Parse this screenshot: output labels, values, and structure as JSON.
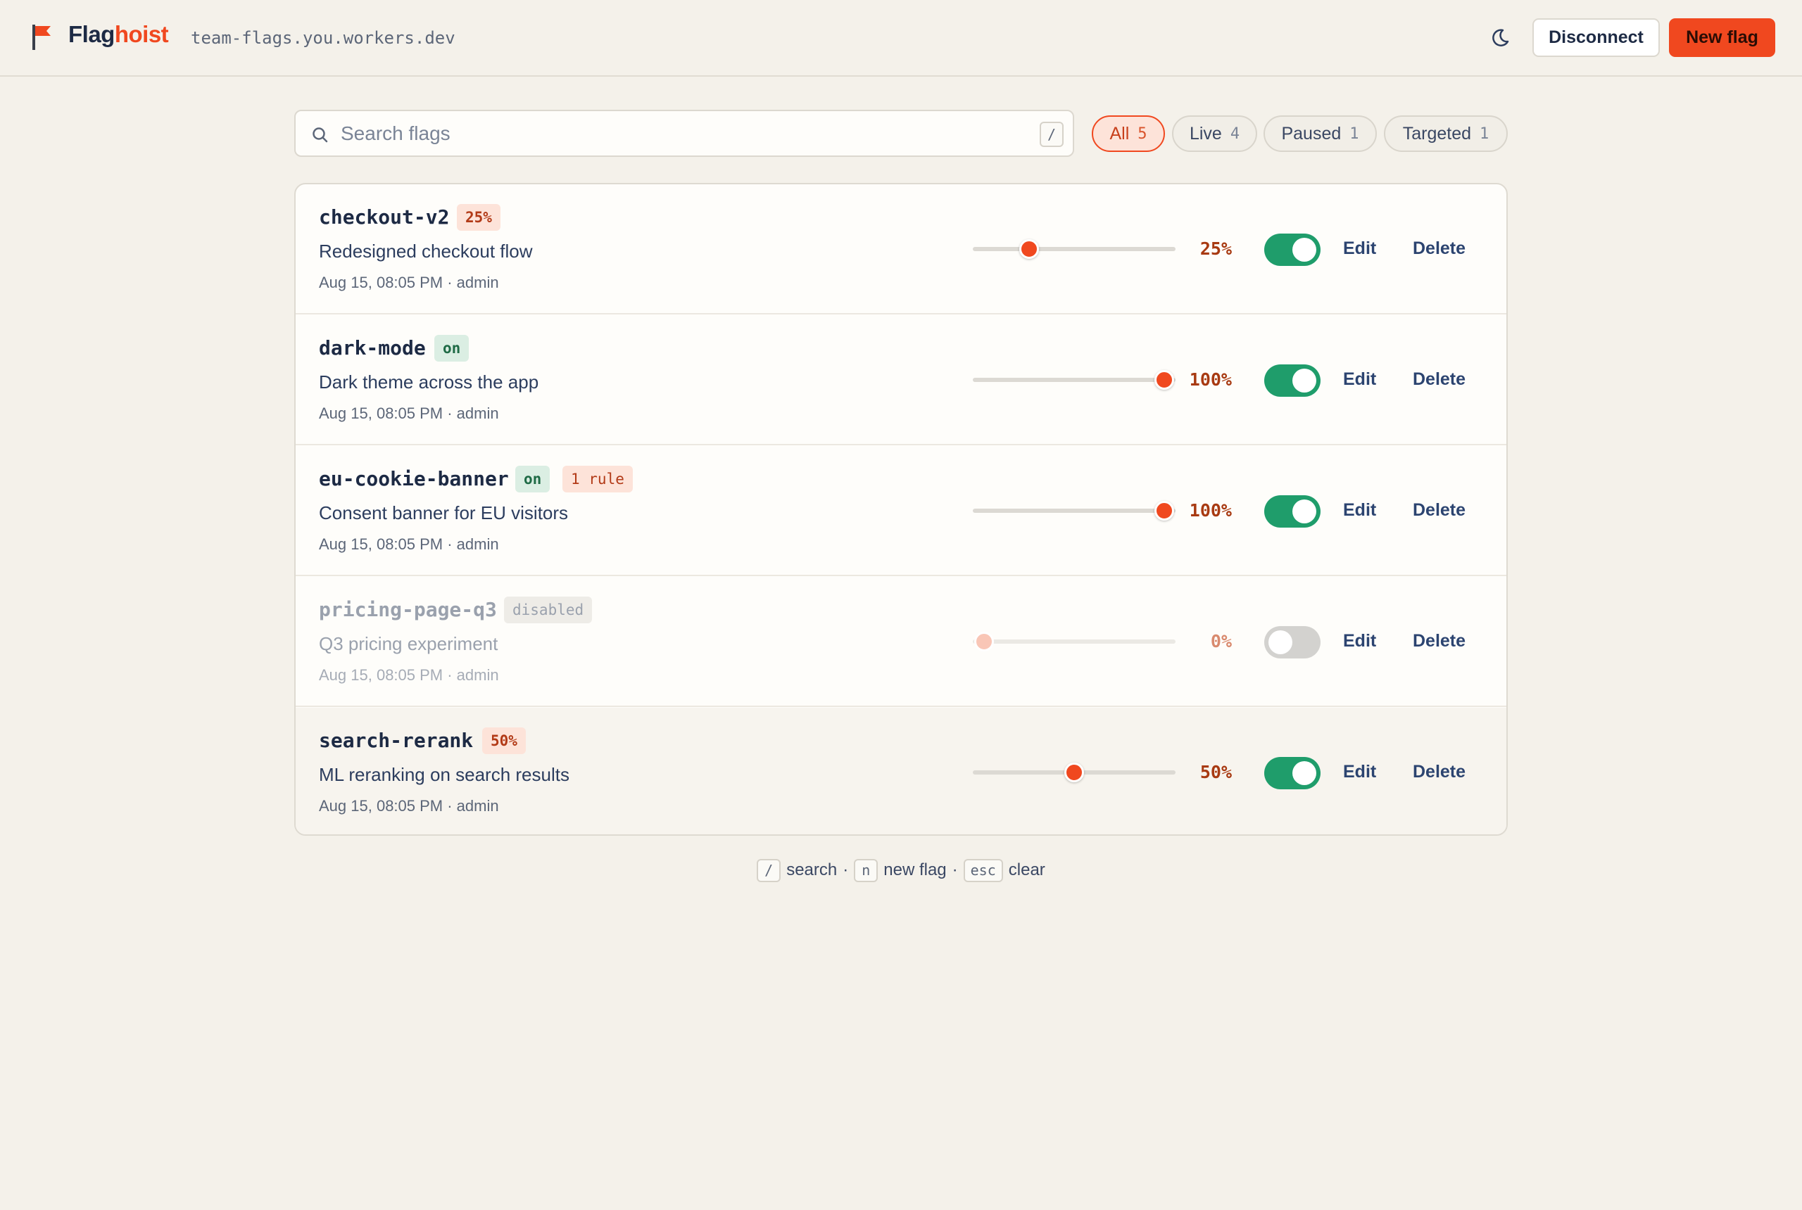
{
  "header": {
    "brand_part1": "Flag",
    "brand_part2": "hoist",
    "host": "team-flags.you.workers.dev",
    "theme_icon": "moon-icon",
    "disconnect_label": "Disconnect",
    "new_flag_label": "New flag"
  },
  "search": {
    "placeholder": "Search flags",
    "value": "",
    "shortcut": "/"
  },
  "filters": [
    {
      "label": "All",
      "count": "5",
      "active": true
    },
    {
      "label": "Live",
      "count": "4",
      "active": false
    },
    {
      "label": "Paused",
      "count": "1",
      "active": false
    },
    {
      "label": "Targeted",
      "count": "1",
      "active": false
    }
  ],
  "flags": [
    {
      "name": "checkout-v2",
      "badges": [
        "25%"
      ],
      "description": "Redesigned checkout flow",
      "meta": "Aug 15, 08:05 PM · admin",
      "rollout": 25,
      "rollout_label": "25%",
      "enabled": true,
      "edit_label": "Edit",
      "delete_label": "Delete"
    },
    {
      "name": "dark-mode",
      "badges": [
        "on"
      ],
      "description": "Dark theme across the app",
      "meta": "Aug 15, 08:05 PM · admin",
      "rollout": 100,
      "rollout_label": "100%",
      "enabled": true,
      "edit_label": "Edit",
      "delete_label": "Delete"
    },
    {
      "name": "eu-cookie-banner",
      "badges": [
        "on",
        "1 rule"
      ],
      "description": "Consent banner for EU visitors",
      "meta": "Aug 15, 08:05 PM · admin",
      "rollout": 100,
      "rollout_label": "100%",
      "enabled": true,
      "edit_label": "Edit",
      "delete_label": "Delete"
    },
    {
      "name": "pricing-page-q3",
      "badges": [
        "disabled"
      ],
      "description": "Q3 pricing experiment",
      "meta": "Aug 15, 08:05 PM · admin",
      "rollout": 0,
      "rollout_label": "0%",
      "enabled": false,
      "edit_label": "Edit",
      "delete_label": "Delete"
    },
    {
      "name": "search-rerank",
      "badges": [
        "50%"
      ],
      "description": "ML reranking on search results",
      "meta": "Aug 15, 08:05 PM · admin",
      "rollout": 50,
      "rollout_label": "50%",
      "enabled": true,
      "edit_label": "Edit",
      "delete_label": "Delete"
    }
  ],
  "hints": {
    "k1": "/",
    "t1": "search",
    "k2": "n",
    "t2": "new flag",
    "k3": "esc",
    "t3": "clear",
    "sep": "·"
  },
  "colors": {
    "accent": "#f0481f",
    "toggle_on": "#1f9d6b",
    "background": "#f4f1ea"
  }
}
